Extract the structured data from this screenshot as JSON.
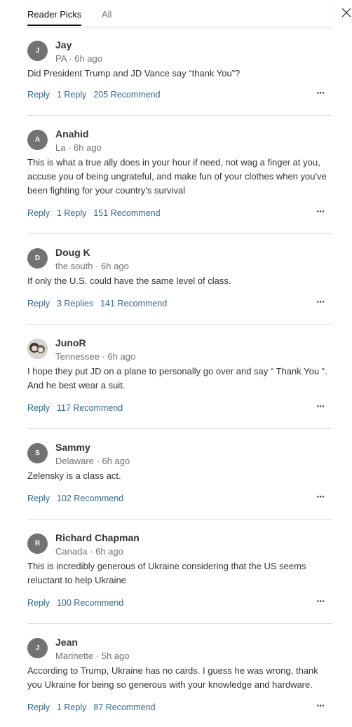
{
  "tabs": {
    "reader_picks": "Reader Picks",
    "all": "All"
  },
  "comments": [
    {
      "initial": "J",
      "name": "Jay",
      "meta": "PA · 6h ago",
      "text": "Did President Trump and JD Vance say “thank You”?",
      "reply": "Reply",
      "replies": "1 Reply",
      "recommend": "205 Recommend"
    },
    {
      "initial": "A",
      "name": "Anahid",
      "meta": "La · 6h ago",
      "text": "This is what a true ally does in your hour if need, not wag a finger at you, accuse you of being ungrateful, and make fun of your clothes when you've been fighting for your country's survival",
      "reply": "Reply",
      "replies": "1 Reply",
      "recommend": "151 Recommend"
    },
    {
      "initial": "D",
      "name": "Doug K",
      "meta": "the south · 6h ago",
      "text": "If only the U.S. could have the same level of class.",
      "reply": "Reply",
      "replies": "3 Replies",
      "recommend": "141 Recommend"
    },
    {
      "initial": "",
      "name": "JunoR",
      "meta": "Tennessee · 6h ago",
      "text": "I hope they put JD on a plane to personally go over and say “ Thank You “. And he best wear a suit.",
      "reply": "Reply",
      "replies": "",
      "recommend": "117 Recommend"
    },
    {
      "initial": "S",
      "name": "Sammy",
      "meta": "Delaware · 6h ago",
      "text": "Zelensky is a class act.",
      "reply": "Reply",
      "replies": "",
      "recommend": "102 Recommend"
    },
    {
      "initial": "R",
      "name": "Richard Chapman",
      "meta": "Canada · 6h ago",
      "text": "This is incredibly generous of Ukraine considering that the US seems reluctant to help Ukraine",
      "reply": "Reply",
      "replies": "",
      "recommend": "100 Recommend"
    },
    {
      "initial": "J",
      "name": "Jean",
      "meta": "Marinette · 5h ago",
      "text": "According to Trump, Ukraine has no cards.  I guess he was wrong, thank you Ukraine for being so generous with your knowledge and hardware.",
      "reply": "Reply",
      "replies": "1 Reply",
      "recommend": "87 Recommend"
    }
  ],
  "icons": {
    "close": "close-icon",
    "more": "more-options-icon",
    "avatar_photo": "avatar-photo"
  },
  "colors": {
    "link": "#326891",
    "avatar_bg": "#727272",
    "meta": "#727272"
  }
}
